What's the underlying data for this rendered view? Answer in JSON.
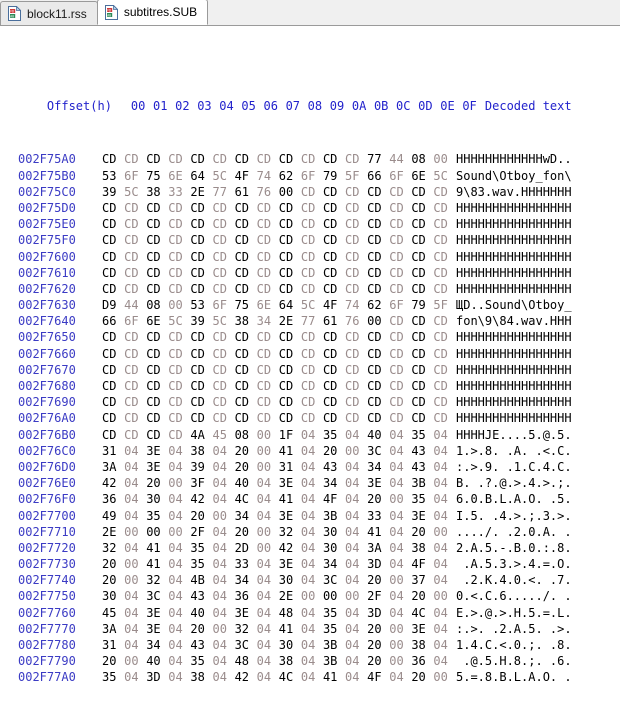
{
  "window": {
    "title": "Hex editor"
  },
  "tabs": [
    {
      "label": "block11.rss",
      "icon": "hex-file-icon",
      "active": false
    },
    {
      "label": "subtitres.SUB",
      "icon": "hex-file-icon",
      "active": true
    }
  ],
  "hex_view": {
    "offset_header": "Offset(h)",
    "column_headers": [
      "00",
      "01",
      "02",
      "03",
      "04",
      "05",
      "06",
      "07",
      "08",
      "09",
      "0A",
      "0B",
      "0C",
      "0D",
      "0E",
      "0F"
    ],
    "decoded_header": "Decoded text",
    "colors": {
      "header": "#2222cc",
      "offset": "#3b3bc4",
      "byte_even": "#000000",
      "byte_odd": "#9a8c8c",
      "ascii": "#000000",
      "background": "#ffffff",
      "tab_bar_background": "#f0f0f0",
      "tab_active_background": "#ffffff",
      "tab_border": "#9a9a9a"
    },
    "rows": [
      {
        "offset": "002F75A0",
        "bytes": [
          "CD",
          "CD",
          "CD",
          "CD",
          "CD",
          "CD",
          "CD",
          "CD",
          "CD",
          "CD",
          "CD",
          "CD",
          "77",
          "44",
          "08",
          "00"
        ],
        "ascii": "HHHHHHHHHHHHwD.."
      },
      {
        "offset": "002F75B0",
        "bytes": [
          "53",
          "6F",
          "75",
          "6E",
          "64",
          "5C",
          "4F",
          "74",
          "62",
          "6F",
          "79",
          "5F",
          "66",
          "6F",
          "6E",
          "5C"
        ],
        "ascii": "Sound\\Otboy_fon\\"
      },
      {
        "offset": "002F75C0",
        "bytes": [
          "39",
          "5C",
          "38",
          "33",
          "2E",
          "77",
          "61",
          "76",
          "00",
          "CD",
          "CD",
          "CD",
          "CD",
          "CD",
          "CD",
          "CD"
        ],
        "ascii": "9\\83.wav.HHHHHHH"
      },
      {
        "offset": "002F75D0",
        "bytes": [
          "CD",
          "CD",
          "CD",
          "CD",
          "CD",
          "CD",
          "CD",
          "CD",
          "CD",
          "CD",
          "CD",
          "CD",
          "CD",
          "CD",
          "CD",
          "CD"
        ],
        "ascii": "HHHHHHHHHHHHHHHH"
      },
      {
        "offset": "002F75E0",
        "bytes": [
          "CD",
          "CD",
          "CD",
          "CD",
          "CD",
          "CD",
          "CD",
          "CD",
          "CD",
          "CD",
          "CD",
          "CD",
          "CD",
          "CD",
          "CD",
          "CD"
        ],
        "ascii": "HHHHHHHHHHHHHHHH"
      },
      {
        "offset": "002F75F0",
        "bytes": [
          "CD",
          "CD",
          "CD",
          "CD",
          "CD",
          "CD",
          "CD",
          "CD",
          "CD",
          "CD",
          "CD",
          "CD",
          "CD",
          "CD",
          "CD",
          "CD"
        ],
        "ascii": "HHHHHHHHHHHHHHHH"
      },
      {
        "offset": "002F7600",
        "bytes": [
          "CD",
          "CD",
          "CD",
          "CD",
          "CD",
          "CD",
          "CD",
          "CD",
          "CD",
          "CD",
          "CD",
          "CD",
          "CD",
          "CD",
          "CD",
          "CD"
        ],
        "ascii": "HHHHHHHHHHHHHHHH"
      },
      {
        "offset": "002F7610",
        "bytes": [
          "CD",
          "CD",
          "CD",
          "CD",
          "CD",
          "CD",
          "CD",
          "CD",
          "CD",
          "CD",
          "CD",
          "CD",
          "CD",
          "CD",
          "CD",
          "CD"
        ],
        "ascii": "HHHHHHHHHHHHHHHH"
      },
      {
        "offset": "002F7620",
        "bytes": [
          "CD",
          "CD",
          "CD",
          "CD",
          "CD",
          "CD",
          "CD",
          "CD",
          "CD",
          "CD",
          "CD",
          "CD",
          "CD",
          "CD",
          "CD",
          "CD"
        ],
        "ascii": "HHHHHHHHHHHHHHHH"
      },
      {
        "offset": "002F7630",
        "bytes": [
          "D9",
          "44",
          "08",
          "00",
          "53",
          "6F",
          "75",
          "6E",
          "64",
          "5C",
          "4F",
          "74",
          "62",
          "6F",
          "79",
          "5F"
        ],
        "ascii": "ЩD..Sound\\Otboy_"
      },
      {
        "offset": "002F7640",
        "bytes": [
          "66",
          "6F",
          "6E",
          "5C",
          "39",
          "5C",
          "38",
          "34",
          "2E",
          "77",
          "61",
          "76",
          "00",
          "CD",
          "CD",
          "CD"
        ],
        "ascii": "fon\\9\\84.wav.HHH"
      },
      {
        "offset": "002F7650",
        "bytes": [
          "CD",
          "CD",
          "CD",
          "CD",
          "CD",
          "CD",
          "CD",
          "CD",
          "CD",
          "CD",
          "CD",
          "CD",
          "CD",
          "CD",
          "CD",
          "CD"
        ],
        "ascii": "HHHHHHHHHHHHHHHH"
      },
      {
        "offset": "002F7660",
        "bytes": [
          "CD",
          "CD",
          "CD",
          "CD",
          "CD",
          "CD",
          "CD",
          "CD",
          "CD",
          "CD",
          "CD",
          "CD",
          "CD",
          "CD",
          "CD",
          "CD"
        ],
        "ascii": "HHHHHHHHHHHHHHHH"
      },
      {
        "offset": "002F7670",
        "bytes": [
          "CD",
          "CD",
          "CD",
          "CD",
          "CD",
          "CD",
          "CD",
          "CD",
          "CD",
          "CD",
          "CD",
          "CD",
          "CD",
          "CD",
          "CD",
          "CD"
        ],
        "ascii": "HHHHHHHHHHHHHHHH"
      },
      {
        "offset": "002F7680",
        "bytes": [
          "CD",
          "CD",
          "CD",
          "CD",
          "CD",
          "CD",
          "CD",
          "CD",
          "CD",
          "CD",
          "CD",
          "CD",
          "CD",
          "CD",
          "CD",
          "CD"
        ],
        "ascii": "HHHHHHHHHHHHHHHH"
      },
      {
        "offset": "002F7690",
        "bytes": [
          "CD",
          "CD",
          "CD",
          "CD",
          "CD",
          "CD",
          "CD",
          "CD",
          "CD",
          "CD",
          "CD",
          "CD",
          "CD",
          "CD",
          "CD",
          "CD"
        ],
        "ascii": "HHHHHHHHHHHHHHHH"
      },
      {
        "offset": "002F76A0",
        "bytes": [
          "CD",
          "CD",
          "CD",
          "CD",
          "CD",
          "CD",
          "CD",
          "CD",
          "CD",
          "CD",
          "CD",
          "CD",
          "CD",
          "CD",
          "CD",
          "CD"
        ],
        "ascii": "HHHHHHHHHHHHHHHH"
      },
      {
        "offset": "002F76B0",
        "bytes": [
          "CD",
          "CD",
          "CD",
          "CD",
          "4A",
          "45",
          "08",
          "00",
          "1F",
          "04",
          "35",
          "04",
          "40",
          "04",
          "35",
          "04"
        ],
        "ascii": "HHHHJE....5.@.5."
      },
      {
        "offset": "002F76C0",
        "bytes": [
          "31",
          "04",
          "3E",
          "04",
          "38",
          "04",
          "20",
          "00",
          "41",
          "04",
          "20",
          "00",
          "3C",
          "04",
          "43",
          "04"
        ],
        "ascii": "1.>.8. .A. .<.C."
      },
      {
        "offset": "002F76D0",
        "bytes": [
          "3A",
          "04",
          "3E",
          "04",
          "39",
          "04",
          "20",
          "00",
          "31",
          "04",
          "43",
          "04",
          "34",
          "04",
          "43",
          "04"
        ],
        "ascii": ":.>.9. .1.C.4.C."
      },
      {
        "offset": "002F76E0",
        "bytes": [
          "42",
          "04",
          "20",
          "00",
          "3F",
          "04",
          "40",
          "04",
          "3E",
          "04",
          "34",
          "04",
          "3E",
          "04",
          "3B",
          "04"
        ],
        "ascii": "B. .?.@.>.4.>.;."
      },
      {
        "offset": "002F76F0",
        "bytes": [
          "36",
          "04",
          "30",
          "04",
          "42",
          "04",
          "4C",
          "04",
          "41",
          "04",
          "4F",
          "04",
          "20",
          "00",
          "35",
          "04"
        ],
        "ascii": "6.0.B.L.A.O. .5."
      },
      {
        "offset": "002F7700",
        "bytes": [
          "49",
          "04",
          "35",
          "04",
          "20",
          "00",
          "34",
          "04",
          "3E",
          "04",
          "3B",
          "04",
          "33",
          "04",
          "3E",
          "04"
        ],
        "ascii": "I.5. .4.>.;.3.>."
      },
      {
        "offset": "002F7710",
        "bytes": [
          "2E",
          "00",
          "00",
          "00",
          "2F",
          "04",
          "20",
          "00",
          "32",
          "04",
          "30",
          "04",
          "41",
          "04",
          "20",
          "00"
        ],
        "ascii": "..../. .2.0.A. ."
      },
      {
        "offset": "002F7720",
        "bytes": [
          "32",
          "04",
          "41",
          "04",
          "35",
          "04",
          "2D",
          "00",
          "42",
          "04",
          "30",
          "04",
          "3A",
          "04",
          "38",
          "04"
        ],
        "ascii": "2.A.5.-.B.0.:.8."
      },
      {
        "offset": "002F7730",
        "bytes": [
          "20",
          "00",
          "41",
          "04",
          "35",
          "04",
          "33",
          "04",
          "3E",
          "04",
          "34",
          "04",
          "3D",
          "04",
          "4F",
          "04"
        ],
        "ascii": " .A.5.3.>.4.=.O."
      },
      {
        "offset": "002F7740",
        "bytes": [
          "20",
          "00",
          "32",
          "04",
          "4B",
          "04",
          "34",
          "04",
          "30",
          "04",
          "3C",
          "04",
          "20",
          "00",
          "37",
          "04"
        ],
        "ascii": " .2.K.4.0.<. .7."
      },
      {
        "offset": "002F7750",
        "bytes": [
          "30",
          "04",
          "3C",
          "04",
          "43",
          "04",
          "36",
          "04",
          "2E",
          "00",
          "00",
          "00",
          "2F",
          "04",
          "20",
          "00"
        ],
        "ascii": "0.<.C.6...../. ."
      },
      {
        "offset": "002F7760",
        "bytes": [
          "45",
          "04",
          "3E",
          "04",
          "40",
          "04",
          "3E",
          "04",
          "48",
          "04",
          "35",
          "04",
          "3D",
          "04",
          "4C",
          "04"
        ],
        "ascii": "E.>.@.>.H.5.=.L."
      },
      {
        "offset": "002F7770",
        "bytes": [
          "3A",
          "04",
          "3E",
          "04",
          "20",
          "00",
          "32",
          "04",
          "41",
          "04",
          "35",
          "04",
          "20",
          "00",
          "3E",
          "04"
        ],
        "ascii": ":.>. .2.A.5. .>."
      },
      {
        "offset": "002F7780",
        "bytes": [
          "31",
          "04",
          "34",
          "04",
          "43",
          "04",
          "3C",
          "04",
          "30",
          "04",
          "3B",
          "04",
          "20",
          "00",
          "38",
          "04"
        ],
        "ascii": "1.4.C.<.0.;. .8."
      },
      {
        "offset": "002F7790",
        "bytes": [
          "20",
          "00",
          "40",
          "04",
          "35",
          "04",
          "48",
          "04",
          "38",
          "04",
          "3B",
          "04",
          "20",
          "00",
          "36",
          "04"
        ],
        "ascii": " .@.5.H.8.;. .6."
      },
      {
        "offset": "002F77A0",
        "bytes": [
          "35",
          "04",
          "3D",
          "04",
          "38",
          "04",
          "42",
          "04",
          "4C",
          "04",
          "41",
          "04",
          "4F",
          "04",
          "20",
          "00"
        ],
        "ascii": "5.=.8.B.L.A.O. ."
      }
    ]
  }
}
